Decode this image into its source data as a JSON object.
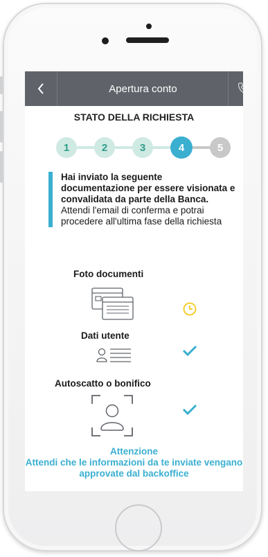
{
  "header": {
    "title": "Apertura conto",
    "back_icon": "chevron-left-icon",
    "call_icon": "phone-icon"
  },
  "status": {
    "title": "STATO DELLA RICHIESTA",
    "steps": [
      {
        "label": "1",
        "state": "done"
      },
      {
        "label": "2",
        "state": "done"
      },
      {
        "label": "3",
        "state": "done"
      },
      {
        "label": "4",
        "state": "current"
      },
      {
        "label": "5",
        "state": "pending"
      }
    ]
  },
  "intro": {
    "bold_text": "Hai inviato la seguente documentazione per essere visionata e convalidata da parte della Banca.",
    "normal_text": "Attendi l'email di conferma e potrai procedere all'ultima fase della richiesta"
  },
  "sections": [
    {
      "title": "Foto documenti",
      "icon": "documents-icon",
      "status": "pending",
      "status_icon": "clock-icon"
    },
    {
      "title": "Dati utente",
      "icon": "user-data-icon",
      "status": "done",
      "status_icon": "checkmark-icon"
    },
    {
      "title": "Autoscatto o bonifico",
      "icon": "selfie-icon",
      "status": "done",
      "status_icon": "checkmark-icon"
    }
  ],
  "attention": {
    "title": "Attenzione",
    "text": "Attendi che le informazioni da te inviate vengano approvate dal backoffice"
  },
  "colors": {
    "accent": "#3aafd0",
    "step_done_bg": "#cfe9e3",
    "step_done_text": "#2f9e8a",
    "step_pending": "#c8c8c8",
    "nav_bg": "#5f6369",
    "pending_icon": "#f3c81b"
  }
}
